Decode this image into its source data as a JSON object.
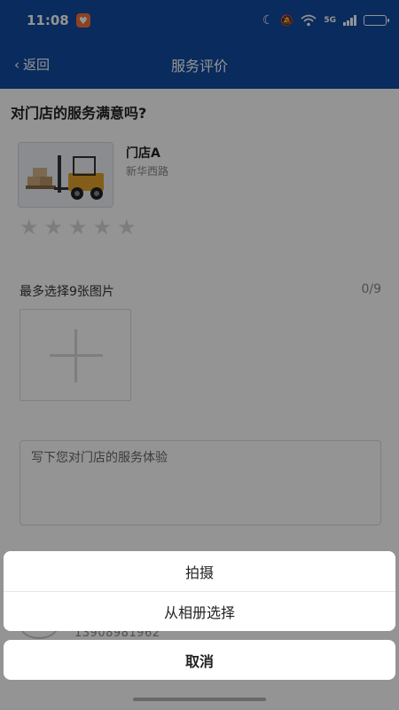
{
  "status_bar": {
    "time": "11:08",
    "network": "5G"
  },
  "navbar": {
    "back_label": "返回",
    "title": "服务评价"
  },
  "review": {
    "question": "对门店的服务满意吗?",
    "store": {
      "name": "门店A",
      "address": "新华西路"
    },
    "rating": 0,
    "max_rating": 5,
    "photos_label": "最多选择9张图片",
    "photos_count": "0/9",
    "comment_placeholder": "写下您对门店的服务体验",
    "contact_phone": "13908981962"
  },
  "action_sheet": {
    "items": [
      {
        "label": "拍摄"
      },
      {
        "label": "从相册选择"
      }
    ],
    "cancel_label": "取消"
  },
  "colors": {
    "header": "#114aa0"
  }
}
